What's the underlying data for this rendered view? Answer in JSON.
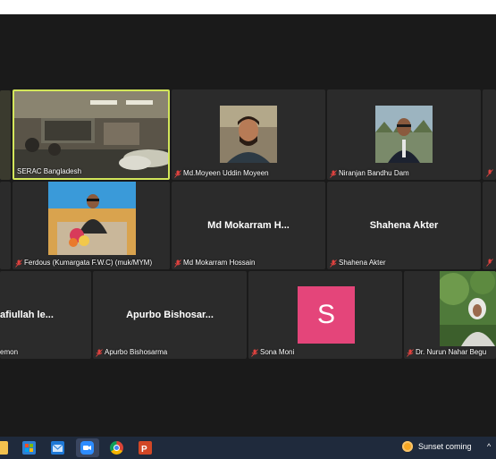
{
  "participants": [
    {
      "id": "serac",
      "label": "SERAC Bangladesh",
      "muted": false,
      "active": true
    },
    {
      "id": "moyeen",
      "label": "Md.Moyeen Uddin Moyeen",
      "muted": true
    },
    {
      "id": "niranjan",
      "label": "Niranjan Bandhu Dam",
      "muted": true
    },
    {
      "id": "ferdous",
      "label": "Ferdous (Kumargata F.W.C) (muk/MYM)",
      "muted": true
    },
    {
      "id": "mokarram",
      "label": "Md Mokarram Hossain",
      "display_name": "Md Mokarram H...",
      "muted": true
    },
    {
      "id": "shahena",
      "label": "Shahena Akter",
      "display_name": "Shahena Akter",
      "muted": true
    },
    {
      "id": "afiullah",
      "label": "emon",
      "display_name": "afiullah le...",
      "muted": false
    },
    {
      "id": "apurbo",
      "label": "Apurbo Bishosarma",
      "display_name": "Apurbo Bishosar...",
      "muted": true
    },
    {
      "id": "sona",
      "label": "Sona Moni",
      "avatar_letter": "S",
      "avatar_color": "#e4457a",
      "muted": true
    },
    {
      "id": "nurun",
      "label": "Dr. Nurun Nahar Begu",
      "muted": true
    }
  ],
  "taskbar": {
    "apps": [
      "file-explorer-icon",
      "store-icon",
      "mail-icon",
      "zoom-icon",
      "chrome-icon",
      "powerpoint-icon"
    ],
    "weather_text": "Sunset coming",
    "tray_caret": "^"
  },
  "colors": {
    "active_border": "#d3e65a",
    "tile_bg": "#2b2b2b",
    "stage_bg": "#1a1a1a",
    "taskbar_bg": "#1f2a3c",
    "mic_muted": "#e0423f"
  }
}
